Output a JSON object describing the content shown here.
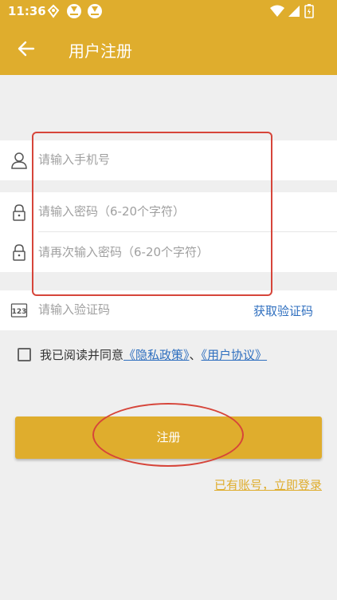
{
  "status_bar": {
    "time": "11:36"
  },
  "app_bar": {
    "title": "用户注册"
  },
  "form": {
    "phone_placeholder": "请输入手机号",
    "password_placeholder": "请输入密码（6-20个字符）",
    "confirm_password_placeholder": "请再次输入密码（6-20个字符）",
    "captcha_placeholder": "请输入验证码",
    "get_code_label": "获取验证码"
  },
  "agreement": {
    "prefix": "我已阅读并同意",
    "privacy_link": "《隐私政策》",
    "separator": "、",
    "user_agreement_link": "《用户协议》"
  },
  "register_button_label": "注册",
  "login_link_label": "已有账号，立即登录",
  "colors": {
    "brand": "#dfad2d",
    "link": "#2f6fbf",
    "annotation": "#d6453a"
  }
}
